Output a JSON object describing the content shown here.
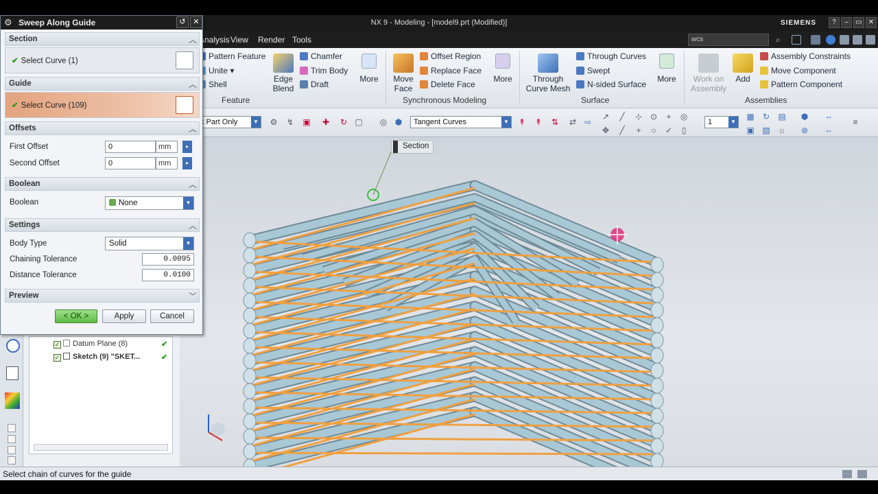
{
  "window": {
    "title": "NX 9 - Modeling - [model9.prt (Modified)]",
    "brand": "SIEMENS",
    "buttons": [
      "?",
      "–",
      "▭",
      "✕"
    ]
  },
  "menubar": {
    "items": [
      "Analysis",
      "View",
      "Render",
      "Tools"
    ],
    "search_value": "wcs"
  },
  "ribbon": {
    "feature": {
      "items": [
        "Pattern Feature",
        "Unite",
        "Shell",
        "Chamfer",
        "Trim Body",
        "Draft"
      ],
      "edge_blend": "Edge Blend",
      "more": "More",
      "group": "Feature"
    },
    "sync": {
      "move_face": "Move Face",
      "items": [
        "Offset Region",
        "Replace Face",
        "Delete Face"
      ],
      "more": "More",
      "group": "Synchronous Modeling"
    },
    "surface": {
      "through_curve_mesh": "Through Curve Mesh",
      "items": [
        "Through Curves",
        "Swept",
        "N-sided Surface"
      ],
      "more": "More",
      "group": "Surface"
    },
    "assemblies": {
      "work_on_assembly": "Work on Assembly",
      "add": "Add",
      "items": [
        "Assembly Constraints",
        "Move Component",
        "Pattern Component"
      ],
      "group": "Assemblies"
    }
  },
  "seltoolbar": {
    "scope_filter": "k Part Only",
    "curve_rule": "Tangent Curves",
    "layer": "1"
  },
  "viewport": {
    "section_label": "Section",
    "colors": {
      "pipe": "#a9c8d6",
      "curve": "#f0a040",
      "marker": "#e0307a"
    }
  },
  "dialog": {
    "title": "Sweep Along Guide",
    "sections": {
      "section": "Section",
      "guide": "Guide",
      "offsets": "Offsets",
      "boolean": "Boolean",
      "settings": "Settings",
      "preview": "Preview"
    },
    "section_select": "Select Curve (1)",
    "guide_select": "Select Curve (109)",
    "first_offset_label": "First Offset",
    "first_offset_value": "0",
    "first_offset_unit": "mm",
    "second_offset_label": "Second Offset",
    "second_offset_value": "0",
    "second_offset_unit": "mm",
    "boolean_label": "Boolean",
    "boolean_value": "None",
    "body_type_label": "Body Type",
    "body_type_value": "Solid",
    "chaining_tol_label": "Chaining Tolerance",
    "chaining_tol_value": "0.0095",
    "distance_tol_label": "Distance Tolerance",
    "distance_tol_value": "0.0100",
    "ok_label": "< OK >",
    "apply_label": "Apply",
    "cancel_label": "Cancel"
  },
  "navigator": {
    "rows": [
      {
        "label": "Datum Plane (8)"
      },
      {
        "label": "Sketch (9) \"SKET..."
      }
    ]
  },
  "status": {
    "text": "Select chain of curves for the guide"
  }
}
